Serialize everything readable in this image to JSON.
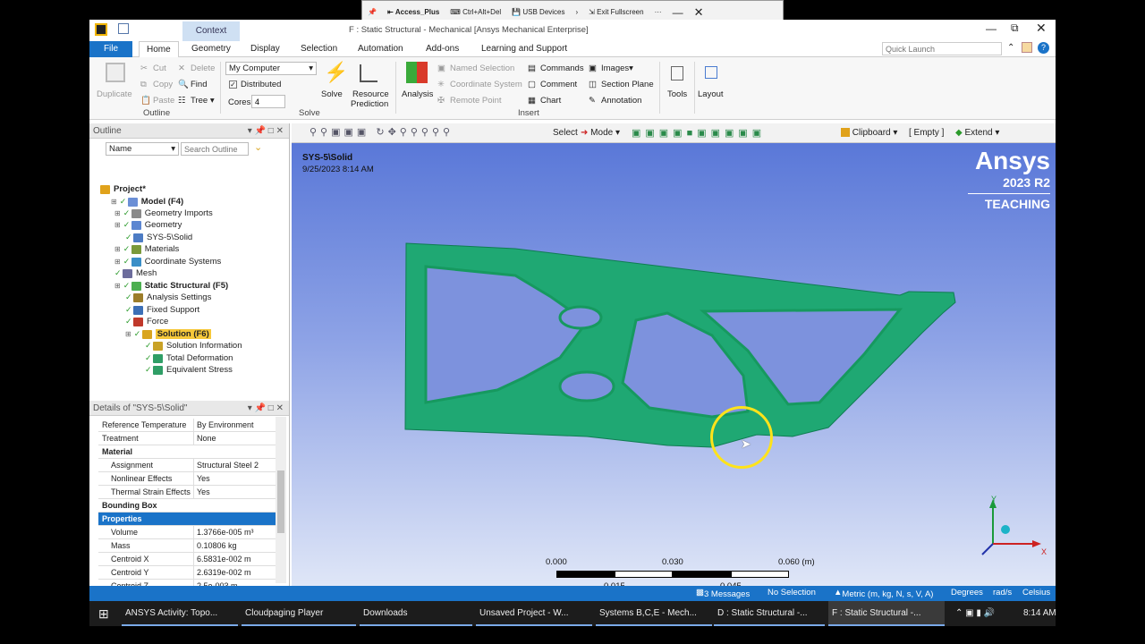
{
  "remote_bar": {
    "pin_icon": "pin-icon",
    "access": "Access_Plus",
    "ctrl_alt_del": "Ctrl+Alt+Del",
    "usb": "USB Devices",
    "fullscreen": "Exit Fullscreen",
    "more": "···"
  },
  "window": {
    "title": "F : Static Structural - Mechanical [Ansys Mechanical Enterprise]",
    "context": "Context"
  },
  "ribbon_tabs": [
    "File",
    "Home",
    "Geometry",
    "Display",
    "Selection",
    "Automation",
    "Add-ons",
    "Learning and Support"
  ],
  "quick_launch": {
    "placeholder": "Quick Launch"
  },
  "ribbon": {
    "outline": {
      "duplicate": "Duplicate",
      "cut": "Cut",
      "delete": "Delete",
      "copy": "Copy",
      "find": "Find",
      "paste": "Paste",
      "tree": "Tree",
      "label": "Outline"
    },
    "solve": {
      "machine": "My Computer",
      "distributed": "Distributed",
      "cores_label": "Cores",
      "cores_value": "4",
      "solve": "Solve",
      "resource": "Resource",
      "prediction": "Prediction",
      "label": "Solve"
    },
    "insert": {
      "analysis": "Analysis",
      "named_selection": "Named Selection",
      "coordinate_system": "Coordinate System",
      "remote_point": "Remote Point",
      "commands": "Commands",
      "comment": "Comment",
      "chart": "Chart",
      "images": "Images",
      "section_plane": "Section Plane",
      "annotation": "Annotation",
      "label": "Insert"
    },
    "tools": "Tools",
    "layout": "Layout"
  },
  "outline_panel": {
    "title": "Outline",
    "name_label": "Name",
    "search_placeholder": "Search Outline"
  },
  "tree": [
    {
      "label": "Project*",
      "bold": true,
      "color": "#e0a21b"
    },
    {
      "label": "Model (F4)",
      "bold": true,
      "color": "#6b8fd6"
    },
    {
      "label": "Geometry Imports",
      "color": "#8a8a8a"
    },
    {
      "label": "Geometry",
      "color": "#5c86d1"
    },
    {
      "label": "SYS-5\\Solid",
      "color": "#4d7cc4"
    },
    {
      "label": "Materials",
      "color": "#7a9a3a"
    },
    {
      "label": "Coordinate Systems",
      "color": "#3a8ec7"
    },
    {
      "label": "Mesh",
      "color": "#6c6c9c"
    },
    {
      "label": "Static Structural (F5)",
      "bold": true,
      "color": "#4caf50"
    },
    {
      "label": "Analysis Settings",
      "color": "#9c7d2a"
    },
    {
      "label": "Fixed Support",
      "color": "#3c6fb6"
    },
    {
      "label": "Force",
      "color": "#c0392b"
    },
    {
      "label": "Solution (F6)",
      "bold": true,
      "color": "#d9a520"
    },
    {
      "label": "Solution Information",
      "color": "#c9a227"
    },
    {
      "label": "Total Deformation",
      "color": "#2f9e66"
    },
    {
      "label": "Equivalent Stress",
      "color": "#2f9e66"
    }
  ],
  "details": {
    "title": "Details of \"SYS-5\\Solid\"",
    "rows1": [
      [
        "Reference Temperature",
        "By Environment"
      ],
      [
        "Treatment",
        "None"
      ]
    ],
    "sec_material": "Material",
    "rows2": [
      [
        "Assignment",
        "Structural Steel 2"
      ],
      [
        "Nonlinear Effects",
        "Yes"
      ],
      [
        "Thermal Strain Effects",
        "Yes"
      ]
    ],
    "sec_bbox": "Bounding Box",
    "sec_props": "Properties",
    "rows3": [
      [
        "Volume",
        "1.3766e-005 m³"
      ],
      [
        "Mass",
        "0.10806 kg"
      ],
      [
        "Centroid X",
        "6.5831e-002 m"
      ],
      [
        "Centroid Y",
        "2.6319e-002 m"
      ],
      [
        "Centroid Z",
        "2.5e-003 m"
      ]
    ]
  },
  "graphics_toolbar": {
    "select": "Select",
    "mode": "Mode",
    "clipboard": "Clipboard",
    "empty": "[ Empty ]",
    "extend": "Extend"
  },
  "viewport": {
    "object": "SYS-5\\Solid",
    "date": "9/25/2023 8:14 AM",
    "brand": "Ansys",
    "version": "2023 R2",
    "edition": "TEACHING",
    "scale": {
      "top": [
        "0.000",
        "0.030",
        "0.060 (m)"
      ],
      "bottom": [
        "0.015",
        "0.045"
      ]
    },
    "triad": {
      "x": "X",
      "y": "Y"
    },
    "model_color": "#1fa873"
  },
  "status": {
    "messages": "3 Messages",
    "selection": "No Selection",
    "units": "Metric (m, kg, N, s, V, A)",
    "degrees": "Degrees",
    "rads": "rad/s",
    "temp": "Celsius"
  },
  "taskbar": {
    "items": [
      "ANSYS Activity: Topo...",
      "Cloudpaging Player",
      "Downloads",
      "Unsaved Project - W...",
      "Systems B,C,E - Mech...",
      "D : Static Structural -...",
      "F : Static Structural -..."
    ],
    "time": "8:14 AM"
  }
}
